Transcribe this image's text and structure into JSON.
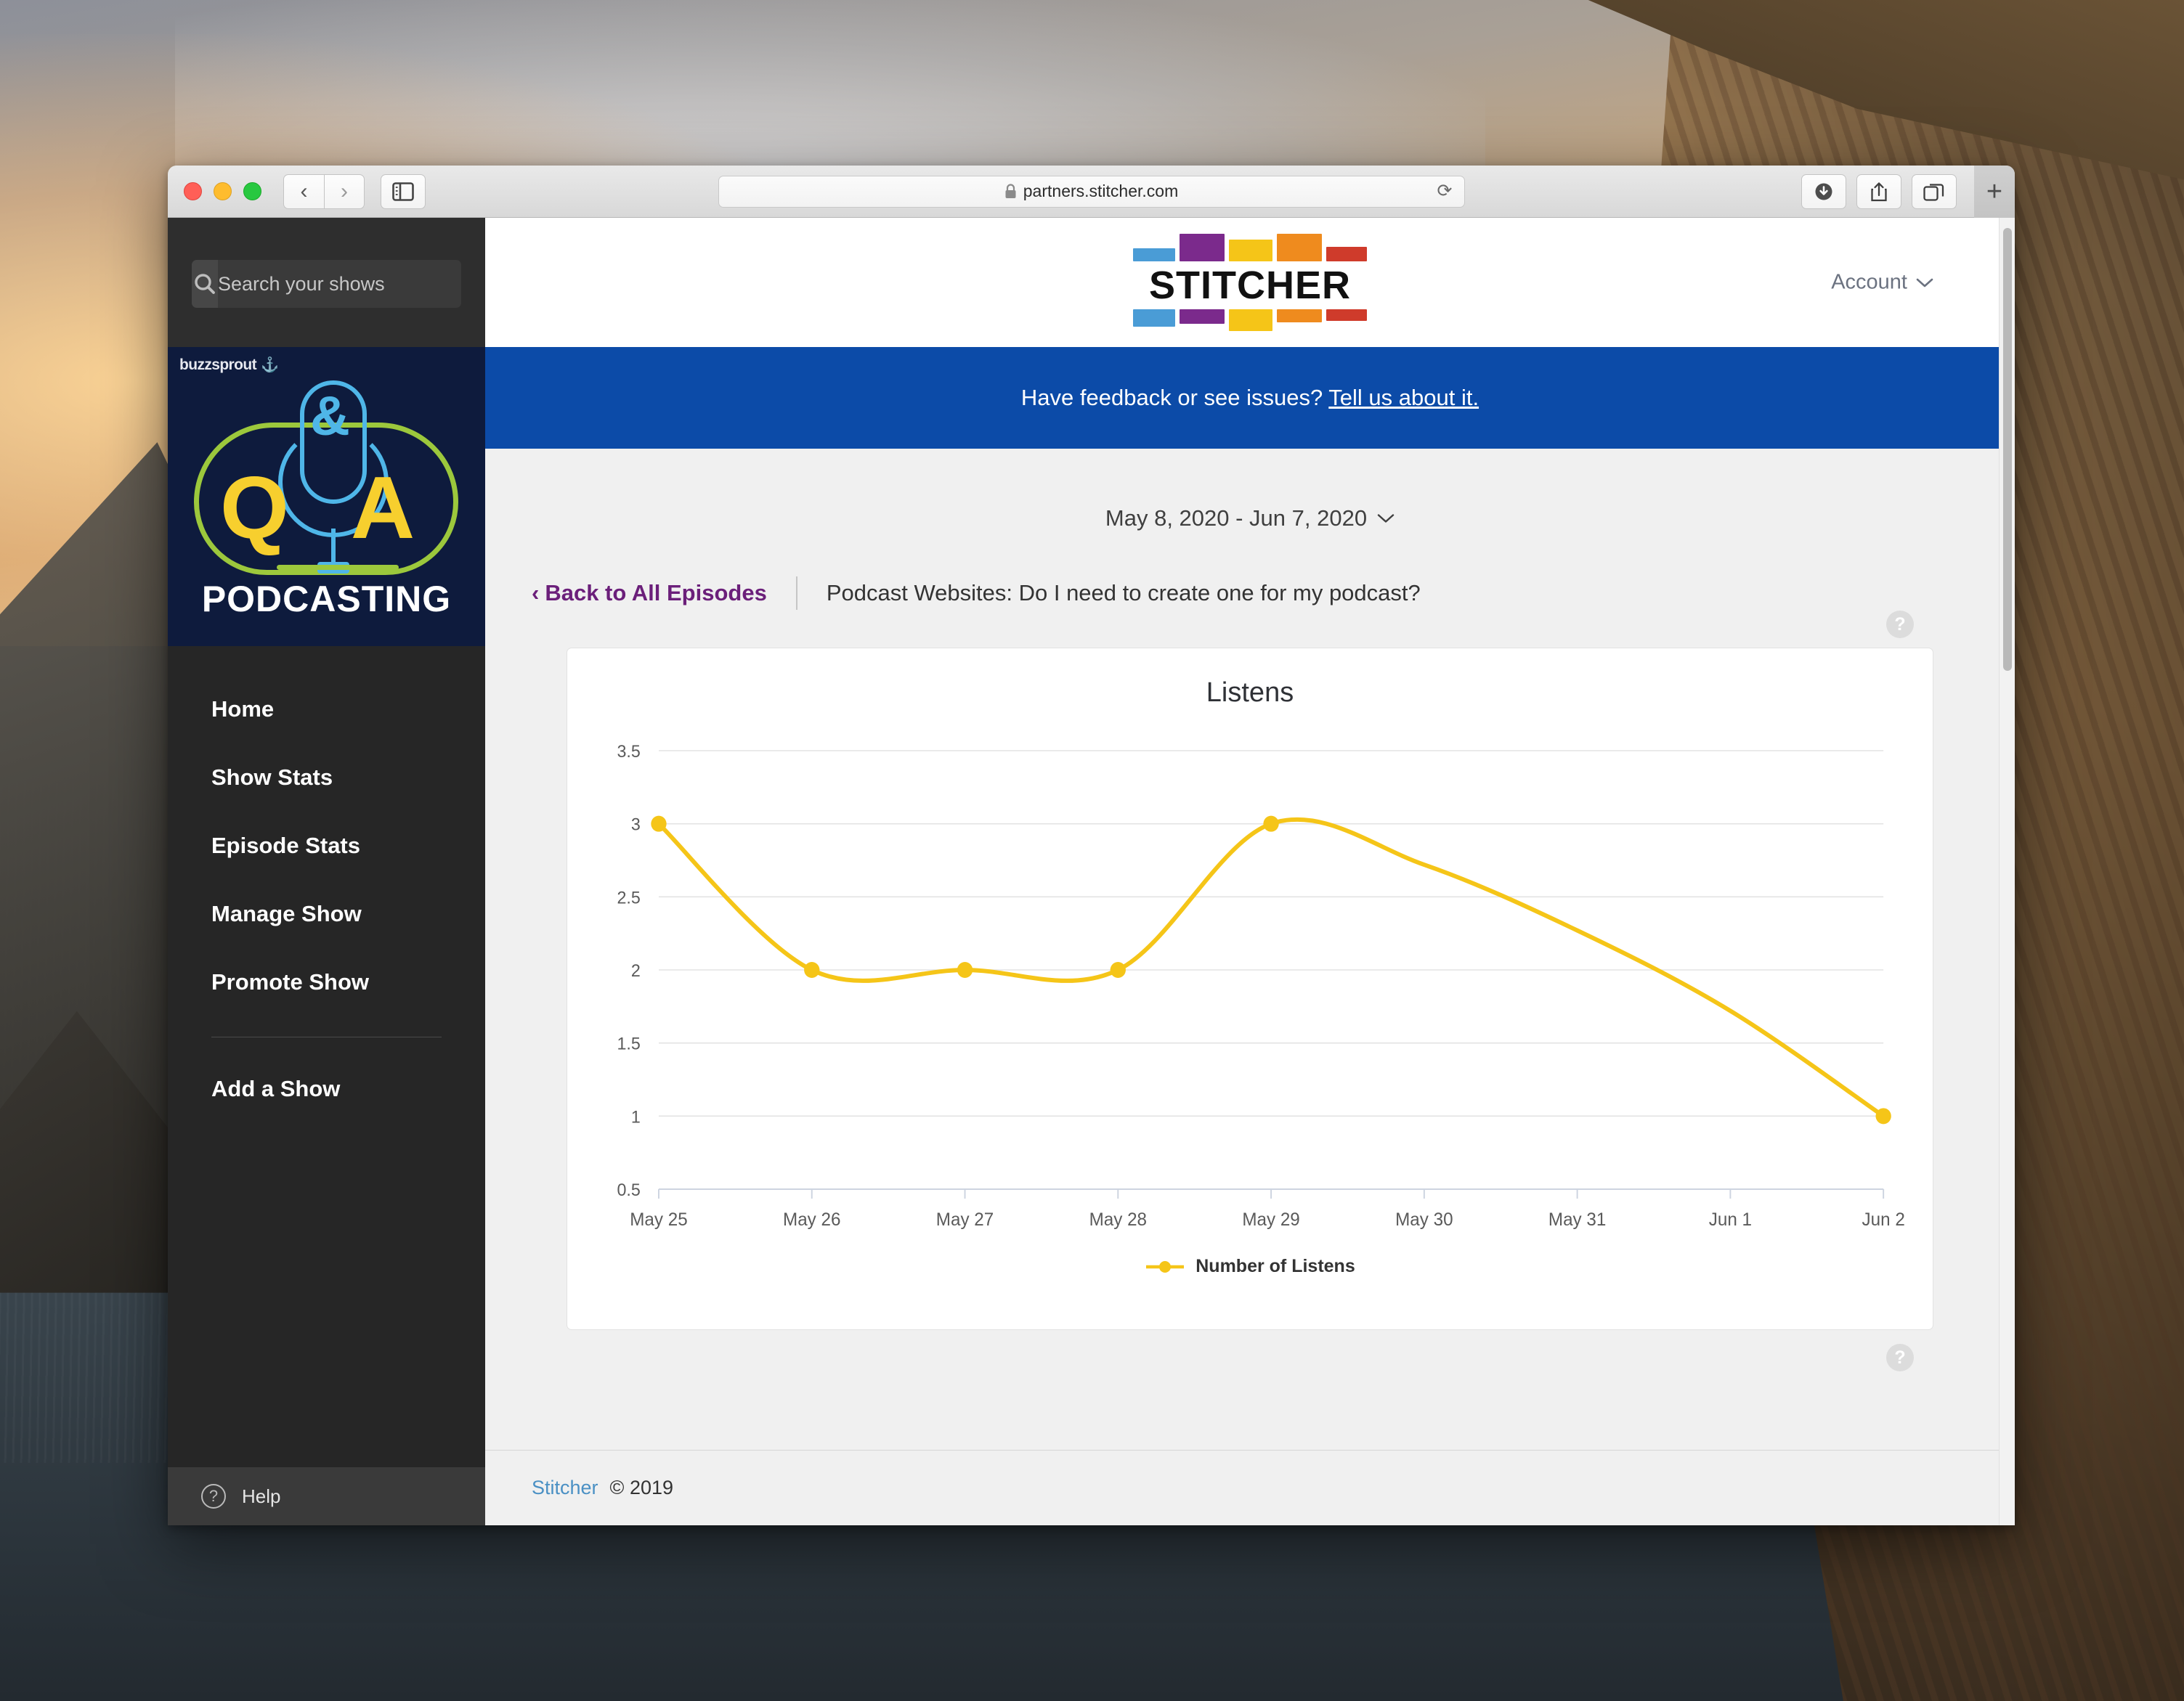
{
  "browser": {
    "url": "partners.stitcher.com",
    "lock_icon": "lock-icon",
    "back_icon": "‹",
    "forward_icon": "›",
    "reload_icon": "⟳",
    "sidebar_icon": "sidebar-icon",
    "downloads_icon": "downloads-icon",
    "share_icon": "share-icon",
    "tabs_icon": "tab-overview-icon",
    "new_tab_icon": "+"
  },
  "sidebar": {
    "search": {
      "placeholder": "Search your shows",
      "value": "",
      "icon": "search-icon"
    },
    "artwork": {
      "provider": "buzzsprout",
      "letter_q": "Q",
      "letter_a": "A",
      "ampersand": "&",
      "title": "PODCASTING"
    },
    "nav_items": [
      {
        "label": "Home"
      },
      {
        "label": "Show Stats"
      },
      {
        "label": "Episode Stats"
      },
      {
        "label": "Manage Show"
      },
      {
        "label": "Promote Show"
      }
    ],
    "secondary_items": [
      {
        "label": "Add a Show"
      }
    ],
    "help": {
      "label": "Help",
      "icon": "question-circle-icon"
    }
  },
  "header": {
    "brand": "STITCHER",
    "brand_colors": [
      "#4a9cd6",
      "#7b2a8c",
      "#f5c518",
      "#ef8b1e",
      "#cf3b2b"
    ],
    "account_label": "Account",
    "account_chevron": "chevron-down-icon"
  },
  "banner": {
    "message": "Have feedback or see issues?",
    "link_label": "Tell us about it.",
    "background": "#0c4ba8"
  },
  "toolbar": {
    "date_range": "May 8, 2020 - Jun 7, 2020",
    "date_chevron": "chevron-down-icon"
  },
  "breadcrumb": {
    "back_chevron": "‹",
    "back_label": "Back to All Episodes",
    "episode_title": "Podcast Websites: Do I need to create one for my podcast?"
  },
  "card": {
    "help_icon_label": "?",
    "legend_label": "Number of Listens"
  },
  "footer": {
    "link_label": "Stitcher",
    "copyright": "© 2019"
  },
  "chart_data": {
    "type": "line",
    "title": "Listens",
    "xlabel": "",
    "ylabel": "",
    "grid": true,
    "legend_position": "bottom",
    "series_color": "#f5c518",
    "categories": [
      "May 25",
      "May 26",
      "May 27",
      "May 28",
      "May 29",
      "May 30",
      "May 31",
      "Jun 1",
      "Jun 2"
    ],
    "series": [
      {
        "name": "Number of Listens",
        "values": [
          3,
          2,
          2,
          2,
          3,
          2.72,
          2.27,
          1.72,
          1
        ]
      }
    ],
    "markers_at": [
      "May 25",
      "May 26",
      "May 27",
      "May 28",
      "May 29",
      "Jun 2"
    ],
    "ylim": [
      0.5,
      3.5
    ],
    "yticks": [
      0.5,
      1,
      1.5,
      2,
      2.5,
      3,
      3.5
    ],
    "ytick_labels": [
      "0.5",
      "1",
      "1.5",
      "2",
      "2.5",
      "3",
      "3.5"
    ]
  }
}
